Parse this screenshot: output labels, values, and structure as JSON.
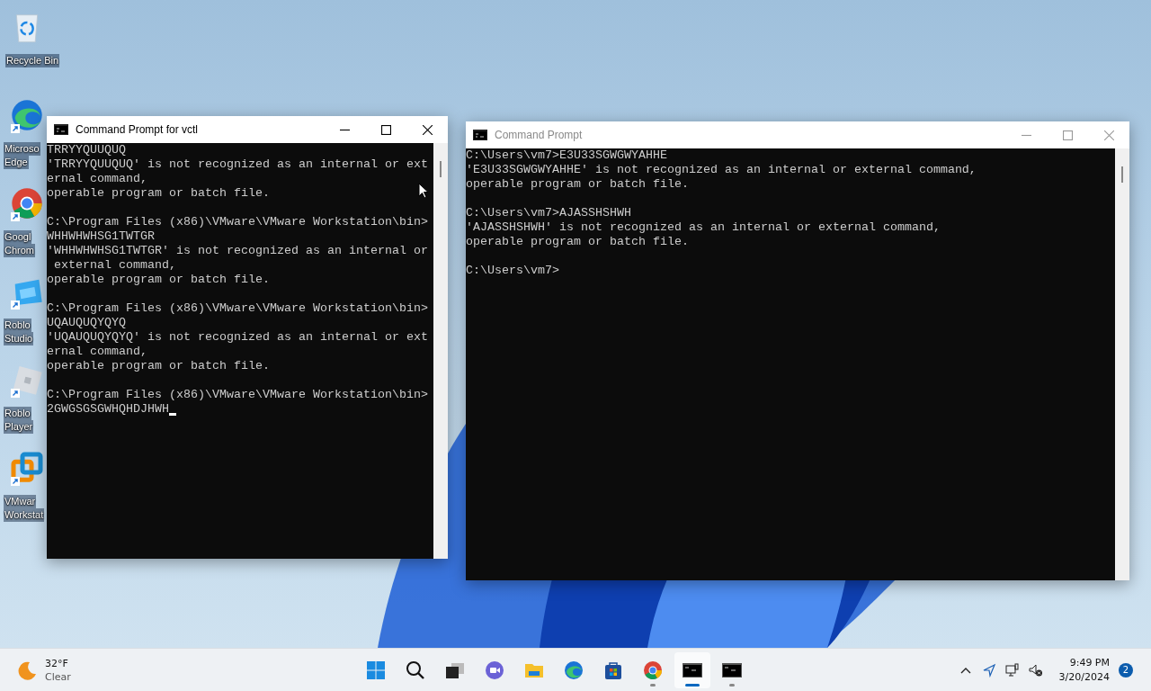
{
  "desktop_icons": [
    {
      "kind": "recycle",
      "lines": [
        "Recycle Bin"
      ]
    },
    {
      "kind": "edge",
      "lines": [
        "Microso",
        "Edge"
      ]
    },
    {
      "kind": "chrome",
      "lines": [
        "Googl",
        "Chrom"
      ]
    },
    {
      "kind": "studio",
      "lines": [
        "Roblo",
        "Studio"
      ]
    },
    {
      "kind": "player",
      "lines": [
        "Roblo",
        "Player"
      ]
    },
    {
      "kind": "vmware",
      "lines": [
        "VMwar",
        "Workstat"
      ]
    }
  ],
  "windows": [
    {
      "title": "Command Prompt for vctl",
      "active": true,
      "cursor": true,
      "blocks": [
        [
          "TRRYYQUUQUQ",
          "'TRRYYQUUQUQ' is not recognized as an internal or ext",
          "ernal command,",
          "operable program or batch file."
        ],
        [
          "C:\\Program Files (x86)\\VMware\\VMware Workstation\\bin>",
          "WHHWHWHSG1TWTGR",
          "'WHHWHWHSG1TWTGR' is not recognized as an internal or",
          " external command,",
          "operable program or batch file."
        ],
        [
          "C:\\Program Files (x86)\\VMware\\VMware Workstation\\bin>",
          "UQAUQUQYQYQ",
          "'UQAUQUQYQYQ' is not recognized as an internal or ext",
          "ernal command,",
          "operable program or batch file."
        ],
        [
          "C:\\Program Files (x86)\\VMware\\VMware Workstation\\bin>",
          "2GWGSGSGWHQHDJHWH"
        ]
      ]
    },
    {
      "title": "Command Prompt",
      "active": false,
      "blocks": [
        [
          "C:\\Users\\vm7>E3U33SGWGWYAHHE",
          "'E3U33SGWGWYAHHE' is not recognized as an internal or external command,",
          "operable program or batch file."
        ],
        [
          "C:\\Users\\vm7>AJASSHSHWH",
          "'AJASSHSHWH' is not recognized as an internal or external command,",
          "operable program or batch file."
        ],
        [
          "C:\\Users\\vm7>"
        ]
      ]
    }
  ],
  "taskbar": {
    "weather": {
      "temperature": "32°F",
      "condition": "Clear"
    },
    "apps": [
      {
        "kind": "start",
        "running": false,
        "selected": false
      },
      {
        "kind": "search",
        "running": false,
        "selected": false
      },
      {
        "kind": "taskview",
        "running": false,
        "selected": false
      },
      {
        "kind": "chat",
        "running": false,
        "selected": false
      },
      {
        "kind": "explorer",
        "running": false,
        "selected": false
      },
      {
        "kind": "edge",
        "running": false,
        "selected": false
      },
      {
        "kind": "store",
        "running": false,
        "selected": false
      },
      {
        "kind": "chrome",
        "running": true,
        "selected": false
      },
      {
        "kind": "terminal",
        "running": true,
        "selected": true
      },
      {
        "kind": "terminal",
        "running": true,
        "selected": false
      }
    ],
    "time": "9:49 PM",
    "date": "3/20/2024",
    "notifications": "2"
  }
}
